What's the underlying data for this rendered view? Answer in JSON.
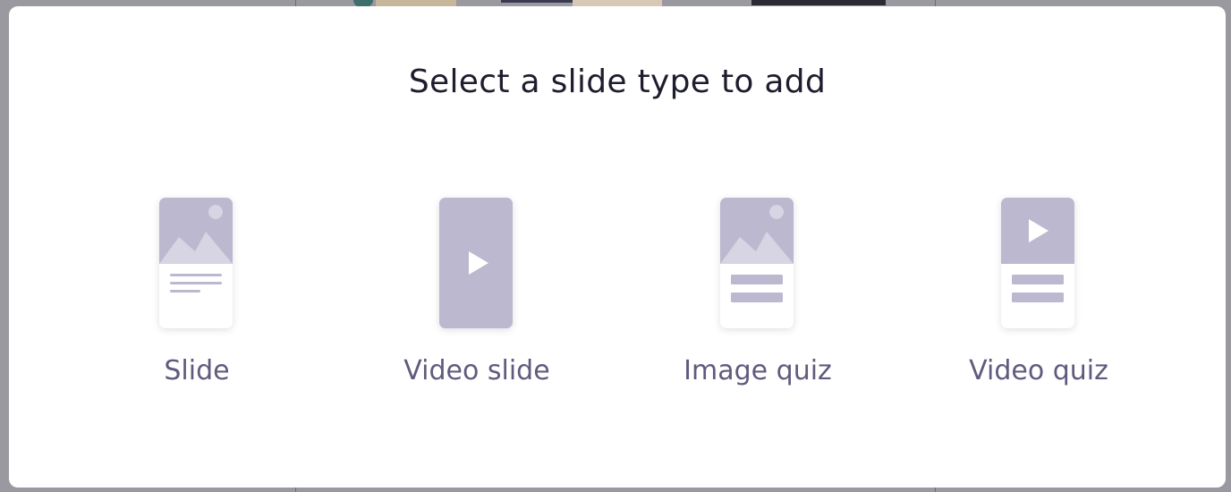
{
  "modal": {
    "title": "Select a slide type to add"
  },
  "options": [
    {
      "label": "Slide",
      "icon": "image-slide-icon"
    },
    {
      "label": "Video slide",
      "icon": "video-slide-icon"
    },
    {
      "label": "Image quiz",
      "icon": "image-quiz-icon"
    },
    {
      "label": "Video quiz",
      "icon": "video-quiz-icon"
    }
  ],
  "colors": {
    "icon_fill": "#bcb8cf",
    "icon_light": "#d7d4e3",
    "label": "#5f5b7e",
    "title": "#1d1d2e",
    "backdrop": "#8e8d94"
  }
}
